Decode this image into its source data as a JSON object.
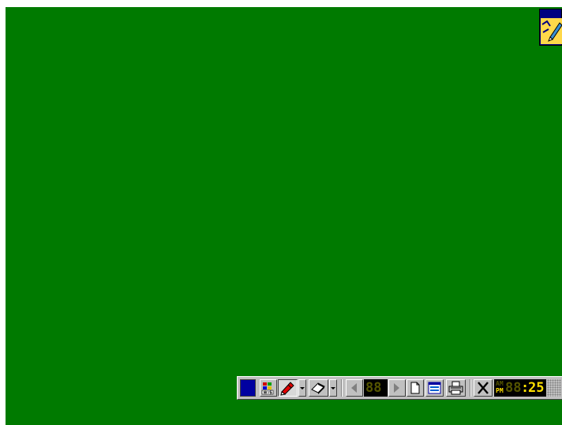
{
  "window": {
    "title": ""
  },
  "toolbar": {
    "page_display": "88",
    "clock": {
      "am_label": "AM",
      "pm_label": "PM",
      "hours": "88",
      "sep": ":",
      "minutes": "25"
    }
  },
  "colors": {
    "board": "#007a00",
    "toolbar_face": "#c0c0c0",
    "pen_color_swatch": "#0000a0",
    "lcd_background": "#000000",
    "lcd_lit": "#ffe000",
    "lcd_unlit": "#555500"
  },
  "icons": [
    "app-icon",
    "palette-icon",
    "pen-icon",
    "eraser-icon",
    "dropdown-arrow-icon",
    "prev-page-icon",
    "next-page-icon",
    "new-page-icon",
    "page-list-icon",
    "print-icon",
    "close-icon"
  ]
}
